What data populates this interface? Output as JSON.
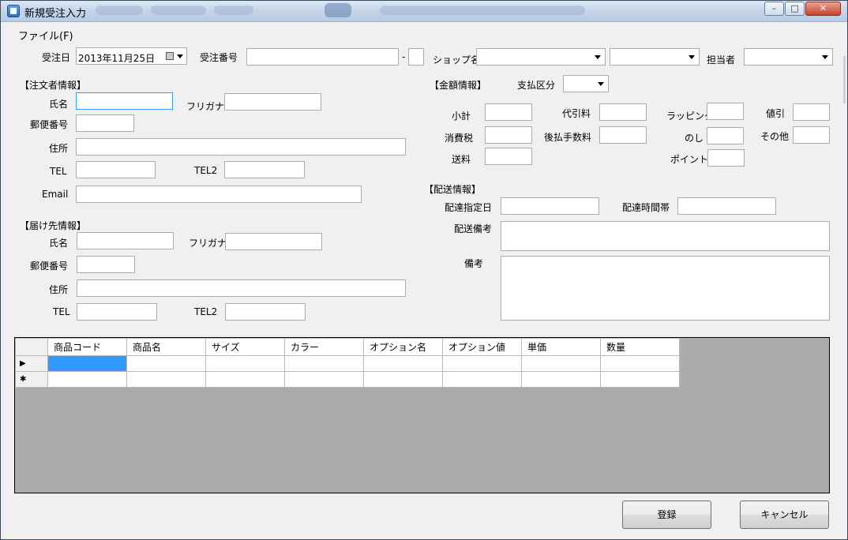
{
  "window": {
    "title": "新規受注入力",
    "controls": {
      "minimize": "–",
      "maximize": "□",
      "close": "✕"
    }
  },
  "menu": {
    "file": "ファイル(F)"
  },
  "header": {
    "order_date_label": "受注日",
    "order_date_value": "2013年11月25日",
    "order_number_label": "受注番号",
    "order_number_sep": "-",
    "shop_label": "ショップ名",
    "staff_label": "担当者"
  },
  "orderer": {
    "section": "【注文者情報】",
    "name_label": "氏名",
    "furigana_label": "フリガナ",
    "zip_label": "郵便番号",
    "address_label": "住所",
    "tel_label": "TEL",
    "tel2_label": "TEL2",
    "email_label": "Email"
  },
  "delivery": {
    "section": "【届け先情報】",
    "name_label": "氏名",
    "furigana_label": "フリガナ",
    "zip_label": "郵便番号",
    "address_label": "住所",
    "tel_label": "TEL",
    "tel2_label": "TEL2"
  },
  "amount": {
    "section": "【金額情報】",
    "payment_label": "支払区分",
    "subtotal_label": "小計",
    "cod_label": "代引料",
    "wrapping_label": "ラッピング",
    "discount_label": "値引",
    "tax_label": "消費税",
    "deferred_fee_label": "後払手数料",
    "noshi_label": "のし",
    "other_label": "その他",
    "shipping_label": "送料",
    "point_label": "ポイント"
  },
  "shipping": {
    "section": "【配送情報】",
    "date_label": "配達指定日",
    "time_label": "配達時間帯",
    "note_label": "配送備考",
    "remarks_label": "備考"
  },
  "grid": {
    "columns": [
      "商品コード",
      "商品名",
      "サイズ",
      "カラー",
      "オプション名",
      "オプション値",
      "単価",
      "数量"
    ],
    "row_markers": [
      "▶",
      "✱"
    ]
  },
  "buttons": {
    "register": "登録",
    "cancel": "キャンセル"
  }
}
